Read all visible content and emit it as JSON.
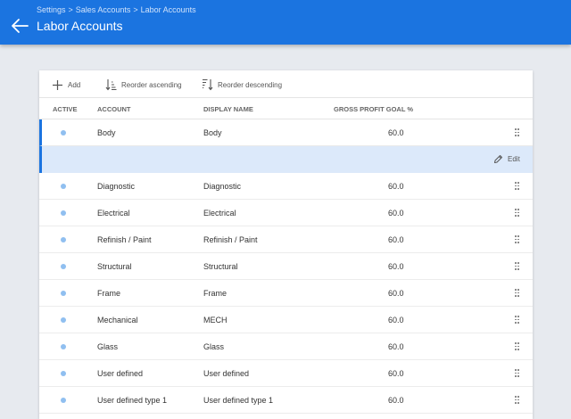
{
  "header": {
    "breadcrumb": [
      "Settings",
      "Sales Accounts",
      "Labor Accounts"
    ],
    "breadcrumb_separator": ">",
    "title": "Labor Accounts",
    "back_icon": "arrow-left-icon"
  },
  "colors": {
    "appbar": "#1b74e0",
    "background": "#e7eaef",
    "selected_row": "#dce9fa",
    "active_dot": "#90bff0"
  },
  "toolbar": {
    "add_label": "Add",
    "reorder_asc_label": "Reorder ascending",
    "reorder_desc_label": "Reorder descending"
  },
  "table": {
    "columns": [
      "ACTIVE",
      "ACCOUNT",
      "DISPLAY NAME",
      "GROSS PROFIT GOAL %"
    ],
    "rows": [
      {
        "account": "Body",
        "display": "Body",
        "goal": "60.0",
        "active": true
      },
      {
        "account": "Diagnostic",
        "display": "Diagnostic",
        "goal": "60.0",
        "active": true
      },
      {
        "account": "Electrical",
        "display": "Electrical",
        "goal": "60.0",
        "active": true
      },
      {
        "account": "Refinish / Paint",
        "display": "Refinish / Paint",
        "goal": "60.0",
        "active": true
      },
      {
        "account": "Structural",
        "display": "Structural",
        "goal": "60.0",
        "active": true
      },
      {
        "account": "Frame",
        "display": "Frame",
        "goal": "60.0",
        "active": true
      },
      {
        "account": "Mechanical",
        "display": "MECH",
        "goal": "60.0",
        "active": true
      },
      {
        "account": "Glass",
        "display": "Glass",
        "goal": "60.0",
        "active": true
      },
      {
        "account": "User defined",
        "display": "User defined",
        "goal": "60.0",
        "active": true
      },
      {
        "account": "User defined type 1",
        "display": "User defined type 1",
        "goal": "60.0",
        "active": true
      }
    ],
    "selected_row": 0
  },
  "row_actions": {
    "edit_label": "Edit"
  }
}
